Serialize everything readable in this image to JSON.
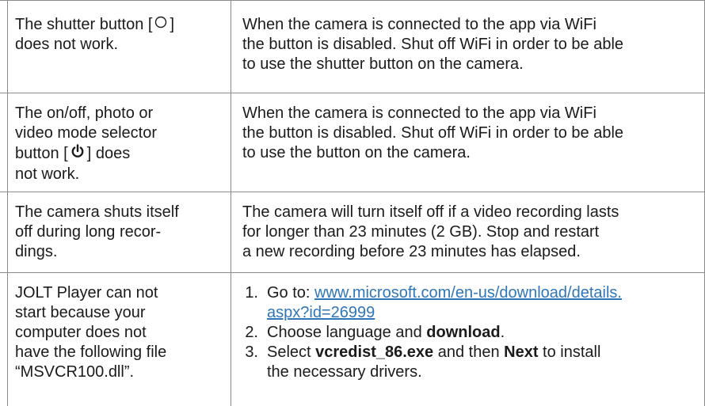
{
  "rows": [
    {
      "problem_lines": [
        "The shutter button [",
        "] ",
        "does not work."
      ],
      "solution_lines": [
        "When the camera is connected to the app via WiFi",
        "the button is disabled. Shut off WiFi in order to be able",
        "to use the shutter button on the camera."
      ]
    },
    {
      "problem_lines": [
        "The on/off, photo or",
        "video mode selector",
        "button [",
        "] does",
        "not work."
      ],
      "solution_lines": [
        "When the camera is connected to the app via WiFi",
        "the button is disabled. Shut off WiFi in order to be able",
        "to use the button on the camera."
      ]
    },
    {
      "problem_lines": [
        "The camera shuts itself",
        "off during long recor-",
        "dings."
      ],
      "solution_lines": [
        "The camera will turn itself off if a video recording lasts",
        "for longer than 23 minutes (2 GB). Stop and restart",
        "a new recording before 23 minutes has elapsed."
      ]
    },
    {
      "problem_lines": [
        "JOLT Player can not",
        "start because your",
        "computer does not",
        "have the following file",
        "“MSVCR100.dll”."
      ],
      "steps": [
        {
          "num": "1.",
          "prefix": "Go to: ",
          "link_line1": "www.microsoft.com/en-us/download/details.",
          "link_line2": "aspx?id=26999"
        },
        {
          "num": "2.",
          "text_before": "Choose language and ",
          "bold": "download",
          "text_after": "."
        },
        {
          "num": "3.",
          "text_before": "Select ",
          "bold1": "vcredist_86.exe",
          "text_middle": " and then ",
          "bold2": "Next",
          "text_after": " to install",
          "line2": "the necessary drivers."
        }
      ]
    }
  ],
  "icons": {
    "shutter": "circle-icon",
    "power": "power-icon"
  },
  "colors": {
    "text": "#1b1b1b",
    "link": "#2f76b9",
    "rule": "#8a8a8a"
  }
}
